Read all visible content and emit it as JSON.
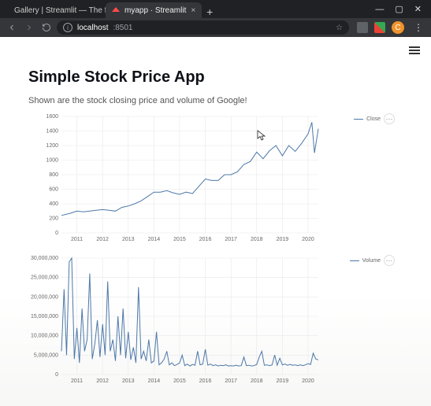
{
  "browser": {
    "tabs": [
      {
        "label": "Gallery | Streamlit — The fastest",
        "active": false
      },
      {
        "label": "myapp · Streamlit",
        "active": true
      }
    ],
    "url_host": "localhost",
    "url_path": ":8501",
    "avatar_initial": "C"
  },
  "page": {
    "title": "Simple Stock Price App",
    "subtitle": "Shown are the stock closing price and volume of Google!"
  },
  "chart_data": [
    {
      "type": "line",
      "legend_label": "Close",
      "xlabel": "",
      "ylabel": "",
      "xlim": [
        2010.4,
        2020.4
      ],
      "ylim": [
        0,
        1600
      ],
      "x_ticks": [
        2011,
        2012,
        2013,
        2014,
        2015,
        2016,
        2017,
        2018,
        2019,
        2020
      ],
      "y_ticks": [
        0,
        200,
        400,
        600,
        800,
        1000,
        1200,
        1400,
        1600
      ],
      "series": [
        {
          "name": "Close",
          "x": [
            2010.4,
            2010.75,
            2011,
            2011.25,
            2011.5,
            2011.75,
            2012,
            2012.25,
            2012.5,
            2012.75,
            2013,
            2013.25,
            2013.5,
            2013.75,
            2014,
            2014.25,
            2014.5,
            2014.75,
            2015,
            2015.25,
            2015.5,
            2015.75,
            2016,
            2016.25,
            2016.5,
            2016.75,
            2017,
            2017.25,
            2017.5,
            2017.75,
            2018,
            2018.25,
            2018.5,
            2018.75,
            2019,
            2019.25,
            2019.5,
            2019.75,
            2020,
            2020.15,
            2020.25,
            2020.4
          ],
          "y": [
            240,
            270,
            300,
            290,
            300,
            310,
            320,
            310,
            300,
            350,
            370,
            400,
            440,
            500,
            560,
            560,
            580,
            550,
            530,
            560,
            540,
            640,
            740,
            720,
            720,
            800,
            800,
            840,
            940,
            980,
            1110,
            1020,
            1130,
            1200,
            1060,
            1200,
            1120,
            1230,
            1360,
            1520,
            1100,
            1430
          ]
        }
      ]
    },
    {
      "type": "line",
      "legend_label": "Volume",
      "xlabel": "",
      "ylabel": "",
      "xlim": [
        2010.4,
        2020.4
      ],
      "ylim": [
        0,
        30000000
      ],
      "x_ticks": [
        2011,
        2012,
        2013,
        2014,
        2015,
        2016,
        2017,
        2018,
        2019,
        2020
      ],
      "y_ticks": [
        0,
        5000000,
        10000000,
        15000000,
        20000000,
        25000000,
        30000000
      ],
      "y_tick_labels": [
        "0",
        "5,000,000",
        "10,000,000",
        "15,000,000",
        "20,000,000",
        "25,000,000",
        "30,000,000"
      ],
      "series": [
        {
          "name": "Volume",
          "x": [
            2010.4,
            2010.5,
            2010.6,
            2010.7,
            2010.8,
            2010.9,
            2011,
            2011.1,
            2011.2,
            2011.3,
            2011.4,
            2011.5,
            2011.6,
            2011.7,
            2011.8,
            2011.9,
            2012,
            2012.1,
            2012.2,
            2012.3,
            2012.4,
            2012.5,
            2012.6,
            2012.7,
            2012.8,
            2012.9,
            2013,
            2013.1,
            2013.2,
            2013.3,
            2013.4,
            2013.5,
            2013.6,
            2013.7,
            2013.8,
            2013.9,
            2014,
            2014.1,
            2014.2,
            2014.3,
            2014.4,
            2014.5,
            2014.6,
            2014.7,
            2014.8,
            2014.9,
            2015,
            2015.1,
            2015.2,
            2015.3,
            2015.4,
            2015.5,
            2015.6,
            2015.7,
            2015.8,
            2015.9,
            2016,
            2016.1,
            2016.2,
            2016.3,
            2016.4,
            2016.5,
            2016.6,
            2016.7,
            2016.8,
            2016.9,
            2017,
            2017.1,
            2017.2,
            2017.3,
            2017.4,
            2017.5,
            2017.6,
            2017.7,
            2017.8,
            2017.9,
            2018,
            2018.1,
            2018.2,
            2018.3,
            2018.4,
            2018.5,
            2018.6,
            2018.7,
            2018.8,
            2018.9,
            2019,
            2019.1,
            2019.2,
            2019.3,
            2019.4,
            2019.5,
            2019.6,
            2019.7,
            2019.8,
            2019.9,
            2020,
            2020.1,
            2020.2,
            2020.3,
            2020.4
          ],
          "y": [
            6000000,
            22000000,
            5000000,
            29000000,
            30000000,
            4000000,
            12000000,
            3000000,
            17000000,
            6000000,
            9000000,
            26000000,
            4000000,
            8000000,
            14000000,
            4500000,
            13000000,
            5000000,
            24000000,
            6000000,
            9000000,
            3500000,
            15000000,
            5000000,
            17000000,
            4200000,
            11000000,
            3800000,
            7000000,
            3000000,
            22500000,
            4000000,
            6000000,
            3500000,
            9000000,
            3000000,
            3500000,
            11000000,
            2500000,
            3000000,
            4000000,
            6000000,
            2500000,
            3000000,
            2300000,
            2600000,
            3000000,
            5000000,
            2300000,
            2700000,
            2200000,
            2600000,
            2400000,
            6000000,
            2500000,
            2700000,
            6500000,
            2400000,
            2700000,
            2300000,
            2500000,
            2200000,
            2400000,
            2300000,
            2500000,
            2200000,
            2300000,
            2200000,
            2400000,
            2200000,
            2300000,
            4500000,
            2300000,
            2400000,
            2200000,
            2300000,
            2600000,
            4500000,
            6000000,
            2400000,
            2500000,
            2300000,
            2500000,
            5000000,
            2400000,
            4200000,
            2500000,
            2700000,
            2400000,
            2600000,
            2400000,
            2500000,
            2300000,
            2500000,
            2300000,
            2500000,
            2800000,
            2600000,
            5500000,
            4000000,
            3800000
          ]
        }
      ]
    }
  ]
}
